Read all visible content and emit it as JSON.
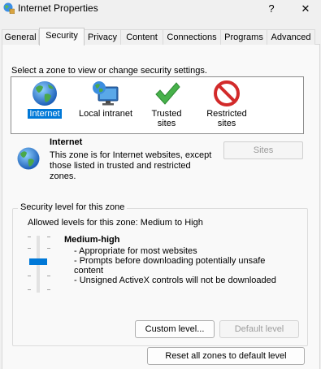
{
  "window": {
    "title": "Internet Properties",
    "help_glyph": "?",
    "close_glyph": "✕"
  },
  "tabs": [
    {
      "label": "General",
      "active": false
    },
    {
      "label": "Security",
      "active": true
    },
    {
      "label": "Privacy",
      "active": false
    },
    {
      "label": "Content",
      "active": false
    },
    {
      "label": "Connections",
      "active": false
    },
    {
      "label": "Programs",
      "active": false
    },
    {
      "label": "Advanced",
      "active": false
    }
  ],
  "security": {
    "zone_prompt": "Select a zone to view or change security settings.",
    "zones": [
      {
        "label": "Internet",
        "icon": "globe-icon",
        "selected": true
      },
      {
        "label": "Local intranet",
        "icon": "intranet-icon",
        "selected": false
      },
      {
        "label": "Trusted sites",
        "icon": "checkmark-icon",
        "selected": false
      },
      {
        "label": "Restricted sites",
        "icon": "restricted-icon",
        "selected": false
      }
    ],
    "selected_zone": {
      "name": "Internet",
      "description": "This zone is for Internet websites, except those listed in trusted and restricted zones."
    },
    "sites_button": "Sites",
    "level_group": {
      "title": "Security level for this zone",
      "allowed": "Allowed levels for this zone: Medium to High",
      "level_name": "Medium-high",
      "bullets": [
        "- Appropriate for most websites",
        "- Prompts before downloading potentially unsafe content",
        "- Unsigned ActiveX controls will not be downloaded"
      ],
      "custom_level_button": "Custom level...",
      "default_level_button": "Default level"
    },
    "reset_button": "Reset all zones to default level"
  },
  "colors": {
    "accent": "#0078d7",
    "window_bg": "#f0f0f0",
    "panel_bg": "#f9f9f9"
  }
}
